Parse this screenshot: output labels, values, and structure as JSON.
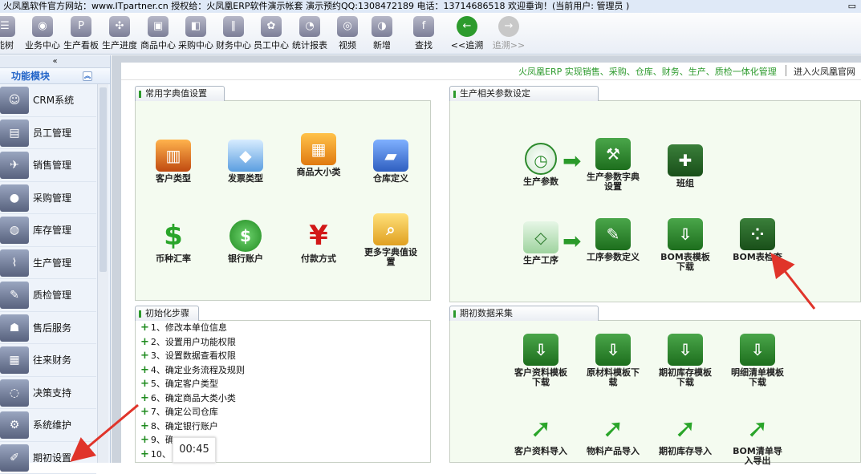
{
  "title_bar": {
    "text": "火凤凰软件官方网站：www.ITpartner.cn  授权给：火凤凰ERP软件演示帐套  演示预约QQ:1308472189  电话：13714686518  欢迎垂询！(当前用户: 管理员 )",
    "window_controls": "▭"
  },
  "toolbar": {
    "items": [
      {
        "label": "能树",
        "icon": "tree-icon"
      },
      {
        "label": "业务中心",
        "icon": "business-icon"
      },
      {
        "label": "生产看板",
        "icon": "board-icon"
      },
      {
        "label": "生产进度",
        "icon": "progress-icon"
      },
      {
        "label": "商品中心",
        "icon": "goods-icon"
      },
      {
        "label": "采购中心",
        "icon": "purchase-icon"
      },
      {
        "label": "财务中心",
        "icon": "finance-icon"
      },
      {
        "label": "员工中心",
        "icon": "staff-icon"
      },
      {
        "label": "统计报表",
        "icon": "report-icon"
      },
      {
        "label": "视频",
        "icon": "video-icon"
      },
      {
        "label": "新增",
        "icon": "add-icon"
      },
      {
        "label": "查找",
        "icon": "find-icon"
      },
      {
        "label": "<<追溯",
        "icon": "back-arrow-icon"
      },
      {
        "label": "追溯>>",
        "icon": "forward-arrow-icon"
      }
    ]
  },
  "sidebar": {
    "collapse_glyph": "«",
    "header": "功能模块",
    "items": [
      {
        "label": "CRM系统",
        "icon": "crm-icon"
      },
      {
        "label": "员工管理",
        "icon": "staff-card-icon"
      },
      {
        "label": "销售管理",
        "icon": "sales-icon"
      },
      {
        "label": "采购管理",
        "icon": "chat-icon"
      },
      {
        "label": "库存管理",
        "icon": "stock-icon"
      },
      {
        "label": "生产管理",
        "icon": "production-icon"
      },
      {
        "label": "质检管理",
        "icon": "quality-icon"
      },
      {
        "label": "售后服务",
        "icon": "service-icon"
      },
      {
        "label": "往来财务",
        "icon": "calculator-icon"
      },
      {
        "label": "决策支持",
        "icon": "decision-icon"
      },
      {
        "label": "系统维护",
        "icon": "gear-icon"
      },
      {
        "label": "期初设置",
        "icon": "notes-icon"
      }
    ]
  },
  "header": {
    "slogan": "火凤凰ERP 实现销售、采购、仓库、财务、生产、质检一体化管理",
    "link": "进入火凤凰官网"
  },
  "panels": {
    "dict": {
      "title": "常用字典值设置",
      "items": [
        {
          "label": "客户类型",
          "icon": "books-icon"
        },
        {
          "label": "发票类型",
          "icon": "invoice-icon"
        },
        {
          "label": "商品大小类",
          "icon": "boxes-icon"
        },
        {
          "label": "仓库定义",
          "icon": "warehouse-folder-icon"
        },
        {
          "label": "币种汇率",
          "icon": "dollar-icon"
        },
        {
          "label": "银行账户",
          "icon": "coin-icon"
        },
        {
          "label": "付款方式",
          "icon": "yen-icon"
        },
        {
          "label": "更多字典值设置",
          "icon": "folder-search-icon"
        }
      ]
    },
    "production": {
      "title": "生产相关参数设定",
      "items": [
        {
          "label": "生产参数",
          "icon": "clock-icon"
        },
        {
          "label": "生产参数字典设置",
          "icon": "hammer-folder-icon"
        },
        {
          "label": "班组",
          "icon": "team-folder-icon"
        },
        {
          "label": "生产工序",
          "icon": "tag-icon"
        },
        {
          "label": "工序参数定义",
          "icon": "clipboard-folder-icon"
        },
        {
          "label": "BOM表模板下载",
          "icon": "download-folder-icon"
        },
        {
          "label": "BOM表检查",
          "icon": "dots-folder-icon"
        }
      ]
    },
    "steps": {
      "title": "初始化步骤",
      "items": [
        "1、修改本单位信息",
        "2、设置用户功能权限",
        "3、设置数据查看权限",
        "4、确定业务流程及规则",
        "5、确定客户类型",
        "6、确定商品大类小类",
        "7、确定公司仓库",
        "8、确定银行账户",
        "9、确",
        "10、"
      ]
    },
    "initial_data": {
      "title": "期初数据采集",
      "items": [
        {
          "label": "客户资料模板下载",
          "icon": "download-folder-icon"
        },
        {
          "label": "原材料模板下载",
          "icon": "download-folder-icon"
        },
        {
          "label": "期初库存模板下载",
          "icon": "download-folder-icon"
        },
        {
          "label": "明细清单模板下载",
          "icon": "download-folder-icon"
        },
        {
          "label": "客户资料导入",
          "icon": "import-arrow-icon"
        },
        {
          "label": "物料产品导入",
          "icon": "import-arrow-icon"
        },
        {
          "label": "期初库存导入",
          "icon": "import-arrow-icon"
        },
        {
          "label": "BOM清单导入导出",
          "icon": "import-arrow-icon"
        }
      ]
    }
  },
  "overlay": {
    "timer": "00:45"
  },
  "colors": {
    "accent_green": "#2c9a2c",
    "panel_bg": "#f4fbf0",
    "annotation_red": "#e0342a",
    "module_header_blue": "#2264c8"
  }
}
